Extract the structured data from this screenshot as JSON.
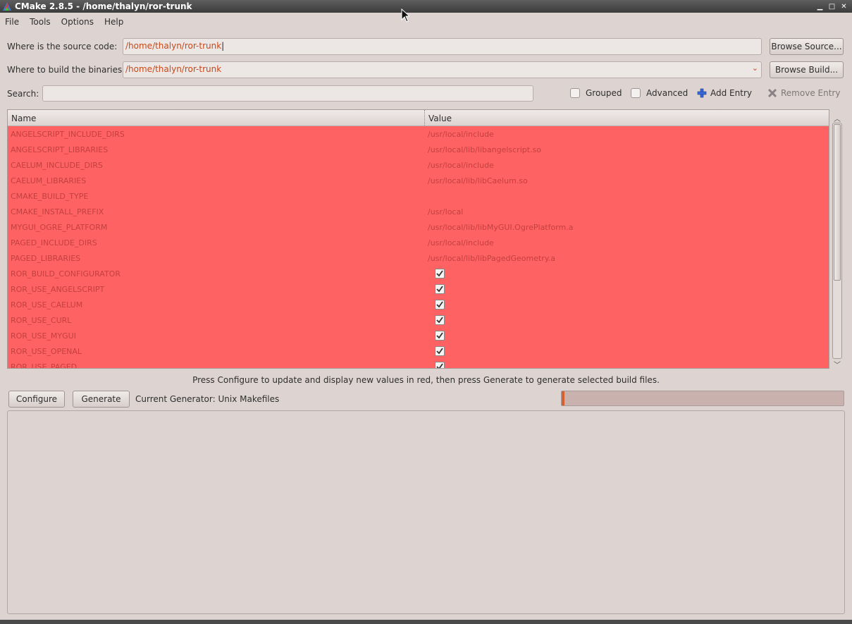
{
  "window": {
    "title": "CMake 2.8.5 - /home/thalyn/ror-trunk"
  },
  "menu": [
    "File",
    "Tools",
    "Options",
    "Help"
  ],
  "source": {
    "label": "Where is the source code:",
    "value": "/home/thalyn/ror-trunk",
    "button": "Browse Source..."
  },
  "build": {
    "label": "Where to build the binaries:",
    "value": "/home/thalyn/ror-trunk",
    "button": "Browse Build..."
  },
  "search": {
    "label": "Search:",
    "value": ""
  },
  "toolbar": {
    "grouped": "Grouped",
    "advanced": "Advanced",
    "add_entry": "Add Entry",
    "remove_entry": "Remove Entry"
  },
  "table": {
    "headers": {
      "name": "Name",
      "value": "Value"
    },
    "rows": [
      {
        "name": "ANGELSCRIPT_INCLUDE_DIRS",
        "value": "/usr/local/include"
      },
      {
        "name": "ANGELSCRIPT_LIBRARIES",
        "value": "/usr/local/lib/libangelscript.so"
      },
      {
        "name": "CAELUM_INCLUDE_DIRS",
        "value": "/usr/local/include"
      },
      {
        "name": "CAELUM_LIBRARIES",
        "value": "/usr/local/lib/libCaelum.so"
      },
      {
        "name": "CMAKE_BUILD_TYPE",
        "value": ""
      },
      {
        "name": "CMAKE_INSTALL_PREFIX",
        "value": "/usr/local"
      },
      {
        "name": "MYGUI_OGRE_PLATFORM",
        "value": "/usr/local/lib/libMyGUI.OgrePlatform.a"
      },
      {
        "name": "PAGED_INCLUDE_DIRS",
        "value": "/usr/local/include"
      },
      {
        "name": "PAGED_LIBRARIES",
        "value": "/usr/local/lib/libPagedGeometry.a"
      },
      {
        "name": "ROR_BUILD_CONFIGURATOR",
        "checkbox": true
      },
      {
        "name": "ROR_USE_ANGELSCRIPT",
        "checkbox": true
      },
      {
        "name": "ROR_USE_CAELUM",
        "checkbox": true
      },
      {
        "name": "ROR_USE_CURL",
        "checkbox": true
      },
      {
        "name": "ROR_USE_MYGUI",
        "checkbox": true
      },
      {
        "name": "ROR_USE_OPENAL",
        "checkbox": true
      },
      {
        "name": "ROR_USE_PAGED",
        "checkbox": true
      }
    ]
  },
  "hint": "Press Configure to update and display new values in red, then press Generate to generate selected build files.",
  "actions": {
    "configure": "Configure",
    "generate": "Generate",
    "generator": "Current Generator: Unix Makefiles"
  },
  "progress": 0.01,
  "colors": {
    "new_entry_bg": "#ff6262",
    "accent": "#d8602e"
  }
}
